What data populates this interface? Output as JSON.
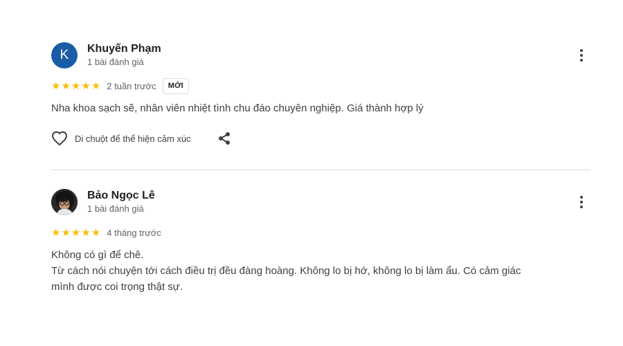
{
  "reviews": [
    {
      "avatar_letter": "K",
      "avatar_color": "#1a5da6",
      "name": "Khuyến Phạm",
      "review_count": "1 bài đánh giá",
      "rating": 5,
      "time": "2 tuần trước",
      "badge": "MỚI",
      "text": [
        "Nha khoa sạch sẽ, nhân viên nhiệt tình chu đáo chuyên nghiệp. Giá thành hợp lý"
      ],
      "react_label": "Di chuột để thể hiện cảm xúc",
      "icons": [
        "heart-outline-icon",
        "share-icon",
        "more-vert-icon"
      ]
    },
    {
      "avatar_type": "photo",
      "name": "Bảo Ngọc Lê",
      "review_count": "1 bài đánh giá",
      "rating": 5,
      "time": "4 tháng trước",
      "text": [
        "Không có gì để chê.",
        "Từ cách nói chuyện tới cách điều trị đều đàng hoàng. Không lo bị hớ, không lo bị làm ẩu. Có cảm giác",
        "mình được coi trọng thật sự."
      ],
      "icons": [
        "more-vert-icon"
      ]
    }
  ],
  "colors": {
    "star": "#fbbc04",
    "divider": "#dadce0",
    "muted_text": "#5f6368"
  }
}
